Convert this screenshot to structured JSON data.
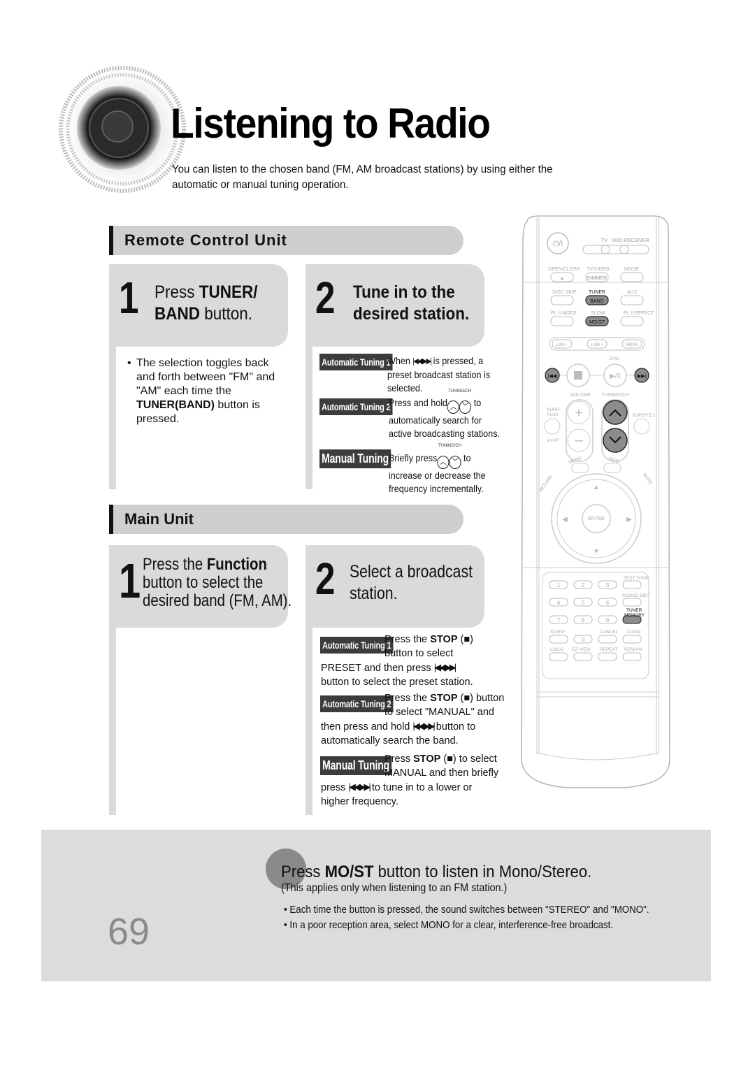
{
  "header": {
    "title": "Listening to Radio",
    "intro": "You can listen to the chosen band (FM, AM broadcast stations) by using either the automatic or manual tuning operation."
  },
  "remote_section": {
    "heading": "Remote Control Unit",
    "step1": {
      "number": "1",
      "line1_pre": "Press ",
      "line1_bold": "TUNER/",
      "line2_bold": "BAND",
      "line2_post": " button.",
      "bullet_pre": "The selection toggles back and forth between \"FM\" and \"AM\" each time the ",
      "bullet_bold": "TUNER(BAND)",
      "bullet_post": " button is pressed."
    },
    "step2": {
      "number": "2",
      "line1": "Tune in to the",
      "line2": "desired station.",
      "items": [
        {
          "badge": "Automatic Tuning 1",
          "pre": "When",
          "icon": "skip-back-forward",
          "post": "is pressed, a preset broadcast station is selected."
        },
        {
          "badge": "Automatic Tuning 2",
          "pre": "Press and hold",
          "icon_label": "TUNING/CH",
          "post": "to automatically search for active broadcasting stations."
        },
        {
          "badge": "Manual Tuning",
          "pre": "Briefly press",
          "icon_label": "TUNING/CH",
          "post": "to increase or decrease the frequency incrementally."
        }
      ]
    }
  },
  "main_section": {
    "heading": "Main Unit",
    "step1": {
      "number": "1",
      "line1_pre": "Press the ",
      "line1_bold": "Function",
      "line2": "button to select the",
      "line3": "desired band (FM, AM)."
    },
    "step2": {
      "number": "2",
      "line1": "Select a broadcast",
      "line2": "station.",
      "items": [
        {
          "badge": "Automatic Tuning 1",
          "t1": "Press the ",
          "b1": "STOP",
          "t2": " (■)",
          "t3": "button to select",
          "t4": "PRESET and then press",
          "t5": "button to select the preset station."
        },
        {
          "badge": "Automatic Tuning 2",
          "t1": "Press the ",
          "b1": "STOP",
          "t2": " (■) button",
          "t3": "to select \"MANUAL\" and",
          "t4": "then press and hold",
          "t4b": "button to",
          "t5": "automatically search the band."
        },
        {
          "badge": "Manual Tuning",
          "t1": "Press ",
          "b1": "STOP",
          "t2": " (■) to select",
          "t3": "MANUAL and then briefly",
          "t4": "press",
          "t4b": "to tune in to a lower or",
          "t5": "higher frequency."
        }
      ]
    }
  },
  "tip": {
    "title_pre": "Press ",
    "title_bold": "MO/ST",
    "title_post": " button to listen in Mono/Stereo.",
    "note": "(This applies only when listening to an FM station.)",
    "bullets": [
      "Each time the button is pressed, the sound switches between \"STEREO\" and \"MONO\".",
      "In a poor reception area, select MONO for a clear, interference-free broadcast."
    ]
  },
  "page_number": "69",
  "remote": {
    "labels": {
      "power": "⏻/I",
      "tv": "TV",
      "dvd_receiver": "DVD RECEIVER",
      "open_close": "OPEN/CLOSE",
      "tv_video": "TV/VIDEO",
      "dimmer": "DIMMER",
      "mode": "MODE",
      "disc_skip": "DISC SKIP",
      "tuner": "TUNER",
      "band": "BAND",
      "aux": "AUX",
      "pl2_mode": "PL II MODE",
      "slow": "SLOW",
      "most": "MO/ST",
      "pl2_effect": "PL II EFFECT",
      "lsm_minus": "LSM –",
      "lsm_plus": "LSM +",
      "rrss": "RRSS",
      "dvd": "DVD",
      "volume": "VOLUME",
      "tuning_ch": "TUNING/CH",
      "surr_plus": "SURR. PLUS",
      "vhp": "V-H/P",
      "super51": "SUPER 5.1",
      "menu": "MENU",
      "info": "INFO",
      "return": "RETURN",
      "mute": "MUTE",
      "enter": "ENTER",
      "test_tone": "TEST TONE",
      "sound_edit": "SOUND EDIT",
      "tuner_memory": "TUNER MEMORY",
      "sleep": "SLEEP",
      "cancel": "CANCEL",
      "zoom": "ZOOM",
      "logo": "LOGO",
      "ez_view": "EZ VIEW",
      "repeat": "REPEAT",
      "remain": "REMAIN"
    },
    "digits": [
      "1",
      "2",
      "3",
      "4",
      "5",
      "6",
      "7",
      "8",
      "9",
      "0"
    ]
  },
  "colors": {
    "section_bg": "#cfcfcf",
    "step_bg": "#dadada",
    "badge_bg": "#3c3c3c",
    "tip_bg": "#dcdcdc",
    "highlight_button": "#8c8c8c"
  }
}
